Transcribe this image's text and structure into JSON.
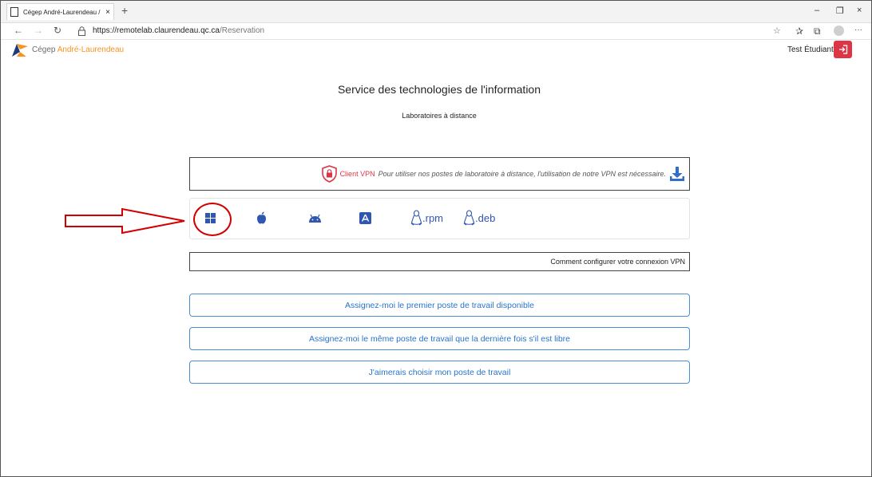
{
  "browser": {
    "tab_title": "Cégep André-Laurendeau / Labo",
    "tab_close": "×",
    "new_tab": "+",
    "window_controls": {
      "minimize": "–",
      "restore": "❐",
      "close": "×"
    },
    "url_base": "https://remotelab.claurendeau.qc.ca",
    "url_path": "/Reservation",
    "more_menu": "···"
  },
  "site": {
    "name_prefix": "Cégep ",
    "name_brand": "André-Laurendeau",
    "user_name": "Test Étudiant",
    "colors": {
      "brand": "#f7941d",
      "danger": "#dc3545",
      "link": "#2a74c9"
    }
  },
  "main": {
    "title": "Service des technologies de l'information",
    "subtitle": "Laboratoires à distance",
    "vpn": {
      "label": "Client VPN",
      "text": "Pour utiliser nos postes de laboratoire à distance, l'utilisation de notre VPN est nécessaire."
    },
    "downloads": [
      {
        "name": "windows-icon",
        "label": ""
      },
      {
        "name": "apple-icon",
        "label": ""
      },
      {
        "name": "android-icon",
        "label": ""
      },
      {
        "name": "app-store-icon",
        "label": ""
      },
      {
        "name": "linux-rpm-icon",
        "label": ".rpm"
      },
      {
        "name": "linux-deb-icon",
        "label": ".deb"
      }
    ],
    "howto_text": "Comment configurer votre connexion VPN",
    "buttons": {
      "first_available": "Assignez-moi le premier poste de travail disponible",
      "same_as_last": "Assignez-moi le même poste de travail que la dernière fois s'il est libre",
      "choose": "J'aimerais choisir mon poste de travail"
    }
  }
}
